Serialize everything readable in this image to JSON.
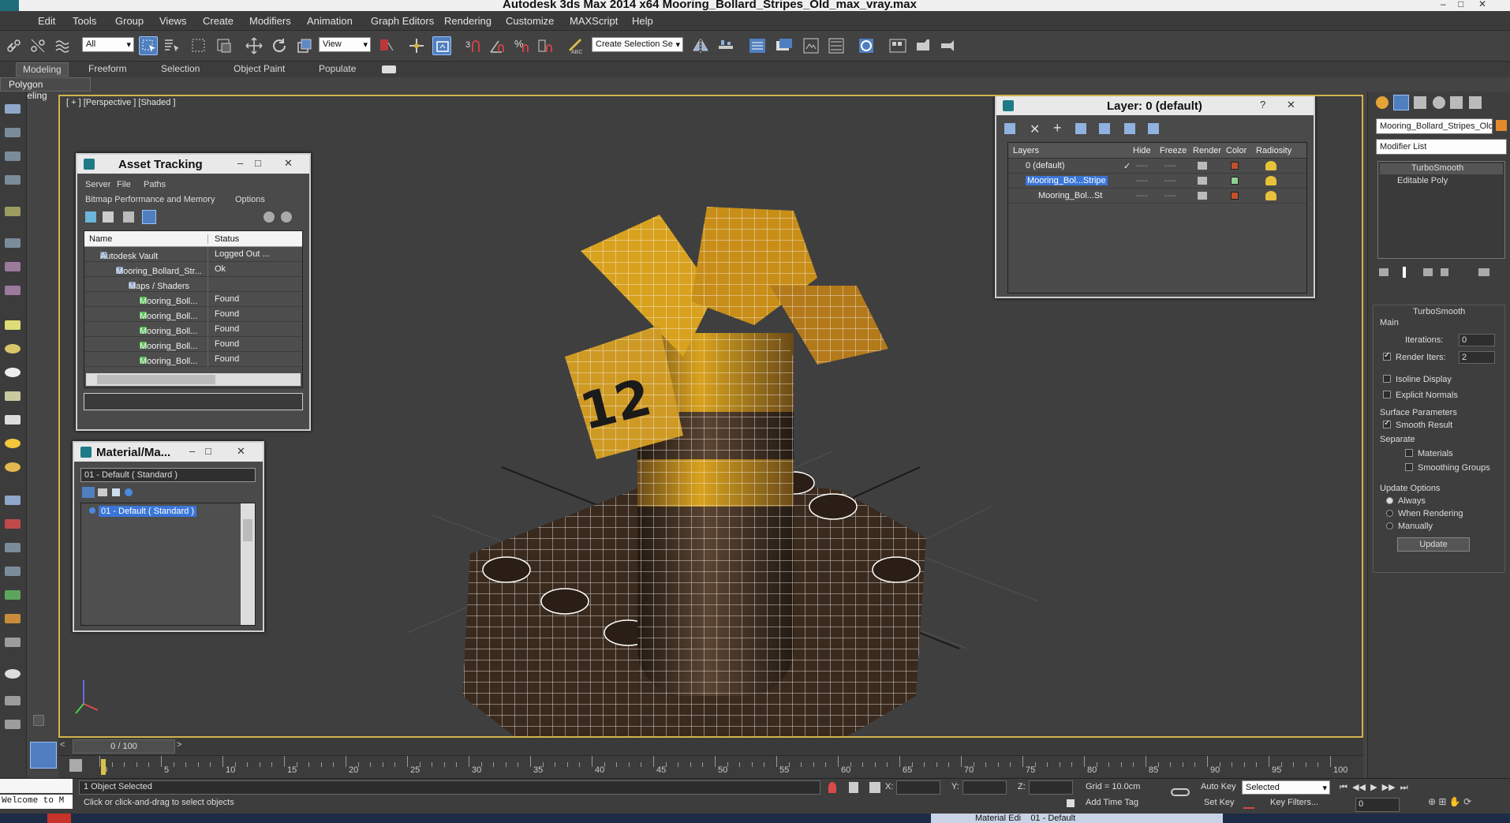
{
  "window": {
    "title": "Autodesk 3ds Max  2014 x64     Mooring_Bollard_Stripes_Old_max_vray.max",
    "minimize": "–",
    "maximize": "□",
    "close": "✕"
  },
  "menu": [
    "Edit",
    "Tools",
    "Group",
    "Views",
    "Create",
    "Modifiers",
    "Animation",
    "Graph Editors",
    "Rendering",
    "Customize",
    "MAXScript",
    "Help"
  ],
  "toolbar": {
    "filter": "All",
    "refcoord": "View",
    "selection_set": "Create Selection Se"
  },
  "ribbon": {
    "tabs": [
      "Modeling",
      "Freeform",
      "Selection",
      "Object Paint",
      "Populate"
    ],
    "active": "Modeling",
    "panel": "Polygon Modeling"
  },
  "viewport": {
    "label": "[ + ] [Perspective ] [Shaded ]",
    "object_number": "12"
  },
  "asset_tracking": {
    "title": "Asset Tracking",
    "menu": [
      "Server",
      "File",
      "Paths"
    ],
    "menu2": [
      "Bitmap Performance and Memory",
      "Options"
    ],
    "columns": [
      "Name",
      "Status"
    ],
    "rows": [
      {
        "name": "Autodesk Vault",
        "status": "Logged Out ...",
        "indent": 20
      },
      {
        "name": "Mooring_Bollard_Str...",
        "status": "Ok",
        "indent": 40
      },
      {
        "name": "Maps / Shaders",
        "status": "",
        "indent": 56
      },
      {
        "name": "Mooring_Boll...",
        "status": "Found",
        "indent": 70
      },
      {
        "name": "Mooring_Boll...",
        "status": "Found",
        "indent": 70
      },
      {
        "name": "Mooring_Boll...",
        "status": "Found",
        "indent": 70
      },
      {
        "name": "Mooring_Boll...",
        "status": "Found",
        "indent": 70
      },
      {
        "name": "Mooring_Boll...",
        "status": "Found",
        "indent": 70
      }
    ]
  },
  "material": {
    "title": "Material/Ma...",
    "field": "01 - Default  ( Standard )",
    "item": "01 - Default  ( Standard )"
  },
  "layer": {
    "title": "Layer: 0 (default)",
    "help": "?",
    "columns": [
      "Layers",
      "Hide",
      "Freeze",
      "Render",
      "Color",
      "Radiosity"
    ],
    "rows": [
      {
        "name": "0 (default)",
        "color": "#c0532b",
        "selected": false
      },
      {
        "name": "Mooring_Bol...Stripe",
        "color": "#8fd18f",
        "selected": true
      },
      {
        "name": "Mooring_Bol...St",
        "color": "#c0532b",
        "selected": false
      }
    ]
  },
  "command_panel": {
    "object_name": "Mooring_Bollard_Stripes_Old",
    "modifier_list": "Modifier List",
    "stack": [
      "TurboSmooth",
      "Editable Poly"
    ],
    "rollout": "TurboSmooth",
    "main": "Main",
    "iterations_label": "Iterations:",
    "iterations": "0",
    "render_iters_label": "Render Iters:",
    "render_iters": "2",
    "isoline": "Isoline Display",
    "explicit": "Explicit Normals",
    "surface": "Surface Parameters",
    "smooth_result": "Smooth Result",
    "separate": "Separate",
    "materials": "Materials",
    "smoothing_groups": "Smoothing Groups",
    "update_options": "Update Options",
    "always": "Always",
    "when_rendering": "When Rendering",
    "manually": "Manually",
    "update": "Update"
  },
  "timeline": {
    "frame": "0 / 100",
    "ticks": [
      "0",
      "5",
      "10",
      "15",
      "20",
      "25",
      "30",
      "35",
      "40",
      "45",
      "50",
      "55",
      "60",
      "65",
      "70",
      "75",
      "80",
      "85",
      "90",
      "95",
      "100"
    ]
  },
  "status": {
    "welcome": "Welcome to M",
    "selected": "1 Object Selected",
    "prompt": "Click or click-and-drag to select objects",
    "x_label": "X:",
    "y_label": "Y:",
    "z_label": "Z:",
    "grid": "Grid = 10.0cm",
    "add_time_tag": "Add Time Tag",
    "auto_key": "Auto Key",
    "set_key": "Set Key",
    "key_mode": "Selected",
    "key_filters": "Key Filters...",
    "frame_field": "0"
  },
  "taskbar": {
    "item1": "Material Edi",
    "item2": "01 - Default"
  },
  "colors": {
    "bollard_yellow": "#d9a21e",
    "bollard_dark": "#3a2a1e",
    "viewport_bg": "#3f3f3f",
    "viewport_border": "#d3b34a",
    "selection_blue": "#3a76d8"
  }
}
